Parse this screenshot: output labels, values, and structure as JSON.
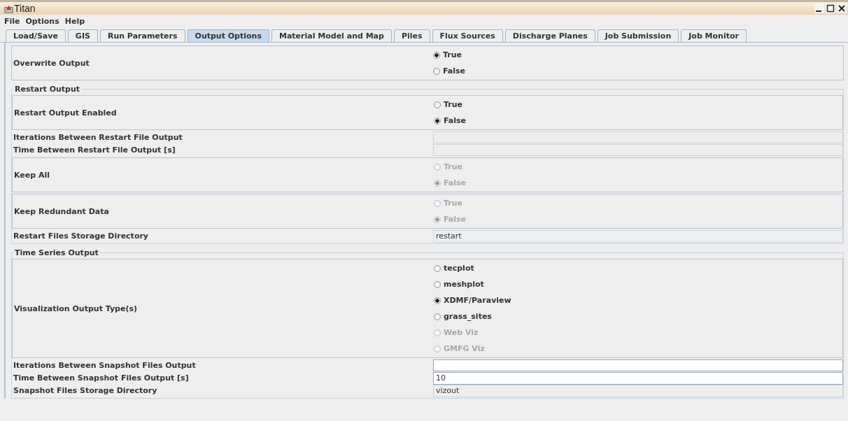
{
  "window": {
    "title": "Titan"
  },
  "menu": [
    "File",
    "Options",
    "Help"
  ],
  "tabs": [
    {
      "label": "Load/Save",
      "selected": false
    },
    {
      "label": "GIS",
      "selected": false
    },
    {
      "label": "Run Parameters",
      "selected": false
    },
    {
      "label": "Output Options",
      "selected": true
    },
    {
      "label": "Material Model and Map",
      "selected": false
    },
    {
      "label": "Piles",
      "selected": false
    },
    {
      "label": "Flux Sources",
      "selected": false
    },
    {
      "label": "Discharge Planes",
      "selected": false
    },
    {
      "label": "Job Submission",
      "selected": false
    },
    {
      "label": "Job Monitor",
      "selected": false
    }
  ],
  "rows": [
    {
      "kind": "radio",
      "label": "Overwrite Output",
      "options": [
        {
          "label": "True",
          "selected": true,
          "disabled": false
        },
        {
          "label": "False",
          "selected": false,
          "disabled": false
        }
      ]
    }
  ],
  "sections": [
    {
      "title": "Restart Output",
      "rows": [
        {
          "kind": "radio",
          "label": "Restart Output Enabled",
          "options": [
            {
              "label": "True",
              "selected": false,
              "disabled": false
            },
            {
              "label": "False",
              "selected": true,
              "disabled": false
            }
          ]
        },
        {
          "kind": "field",
          "label": "Iterations Between Restart File Output",
          "editable": false
        },
        {
          "kind": "field",
          "label": "Time Between Restart File Output [s]",
          "editable": false
        },
        {
          "kind": "radio",
          "label": "Keep All",
          "options": [
            {
              "label": "True",
              "selected": false,
              "disabled": true
            },
            {
              "label": "False",
              "selected": true,
              "disabled": true
            }
          ]
        },
        {
          "kind": "radio",
          "label": "Keep Redundant Data",
          "options": [
            {
              "label": "True",
              "selected": false,
              "disabled": true
            },
            {
              "label": "False",
              "selected": true,
              "disabled": true
            }
          ]
        },
        {
          "kind": "field",
          "label": "Restart Files Storage Directory",
          "value": "restart",
          "editable": false
        }
      ]
    },
    {
      "title": "Time Series Output",
      "rows": [
        {
          "kind": "radio",
          "label": "Visualization Output Type(s)",
          "options": [
            {
              "label": "tecplot",
              "selected": false,
              "disabled": false
            },
            {
              "label": "meshplot",
              "selected": false,
              "disabled": false
            },
            {
              "label": "XDMF/Paraview",
              "selected": true,
              "disabled": false
            },
            {
              "label": "grass_sites",
              "selected": false,
              "disabled": false
            },
            {
              "label": "Web Viz",
              "selected": false,
              "disabled": true
            },
            {
              "label": "GMFG Viz",
              "selected": false,
              "disabled": true
            }
          ]
        },
        {
          "kind": "field",
          "label": "Iterations Between Snapshot Files Output",
          "editable": true
        },
        {
          "kind": "field",
          "label": "Time Between Snapshot Files Output [s]",
          "value": "10",
          "editable": true
        },
        {
          "kind": "field",
          "label": "Snapshot Files Storage Directory",
          "value": "vizout",
          "editable": false
        }
      ]
    }
  ]
}
